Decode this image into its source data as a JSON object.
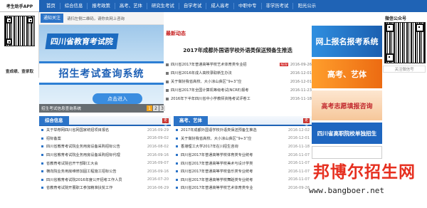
{
  "app": {
    "title": "考生助手APP",
    "caption": "查成绩、查录取"
  },
  "nav": [
    "首页",
    "综合信息",
    "报考政策",
    "高考、艺体",
    "研究生考试",
    "自学考试",
    "成人高考",
    "中职中专",
    "非学历考试",
    "阳光公示"
  ],
  "notice": {
    "tag": "通知关注",
    "text": "请扫左侧二维码，请你去网上咨询"
  },
  "banner": {
    "title": "四川省教育考试院",
    "subtitle": "招生考试查询系统",
    "button": "点击进入",
    "caption": "招生考试信息查询系统",
    "pages": [
      "1",
      "2",
      "3"
    ]
  },
  "news": {
    "heading": "最新动态",
    "headline": "2017年成都外国语学校外语类保送预备生推选",
    "rows": [
      {
        "title": "四川省2017年普通高等学校艺术体育类专业招",
        "date": "2016-09-26",
        "new": "NEW"
      },
      {
        "title": "四川省2016年成人高校录取新生办法",
        "date": "2016-12-01",
        "new": ""
      },
      {
        "title": "关于做好我省高校、大小凉山彝区“9+3”应",
        "date": "2016-12-01",
        "new": ""
      },
      {
        "title": "四川省2017年全国计算机等级考试(NCRE)报考",
        "date": "2016-11-23",
        "new": ""
      },
      {
        "title": "2016年下半年四川省中小学教师资格考试评卷工",
        "date": "2016-11-18",
        "new": ""
      }
    ]
  },
  "wechat": {
    "heading": "微信公众号",
    "caption": "关注微信号"
  },
  "side_cards": [
    "网上报名报考系统",
    "高考、艺体",
    "高考志愿填报咨询",
    "四川省高职院校单独招生"
  ],
  "section_left": {
    "title": "综合信息",
    "more": "更多",
    "rows": [
      {
        "t": "关于举荐网四川省网国家统招项目报名",
        "d": "2016-09-29"
      },
      {
        "t": "招标备案",
        "d": "2016-09-02"
      },
      {
        "t": "四川省教育考试院业务用房设备采购招标公告",
        "d": "2016-08-02"
      },
      {
        "t": "四川省教育考试院业务用房设备采购招标代理",
        "d": "2016-09-16"
      },
      {
        "t": "省教育考试院召开干部职工大会",
        "d": "2016-09-07"
      },
      {
        "t": "横向院业务用房维修加固工程施工招标公告",
        "d": "2016-09-16"
      },
      {
        "t": "四川省教育考试院2016年度公开招考工作人员",
        "d": "2016-07-20"
      },
      {
        "t": "省教育考试院开展职工参加精准扶贫工作",
        "d": "2016-06-29"
      }
    ]
  },
  "section_right": {
    "title": "高考、艺体",
    "more": "更多",
    "rows": [
      {
        "t": "2017年成都外国语学校外语类保送预备生推选",
        "d": "2016-12-02"
      },
      {
        "t": "关于做好我省高校、大小凉山彝区“9+3”应",
        "d": "2016-12-01"
      },
      {
        "t": "香港理工大学2017年在川招生咨询",
        "d": "2016-11-18"
      },
      {
        "t": "四川省2017年普通高等学校体育类专业统考",
        "d": "2016-11-07"
      },
      {
        "t": "四川省2017年普通高等学校美术与设计学类",
        "d": "2016-11-07"
      },
      {
        "t": "四川省2017年普通高等学校音乐类专业统考",
        "d": "2016-11-07"
      },
      {
        "t": "四川省2017年普通高等学校舞蹈类专业统考",
        "d": "2016-11-07"
      },
      {
        "t": "四川省2017年普通高等学校艺术体育类专业",
        "d": "2016-09-26"
      }
    ]
  },
  "watermark": {
    "text": "邦博尔招生网",
    "url": "www.bangboer.net"
  },
  "colors": {
    "primary": "#1f63b5",
    "accent": "#c51b1b"
  }
}
